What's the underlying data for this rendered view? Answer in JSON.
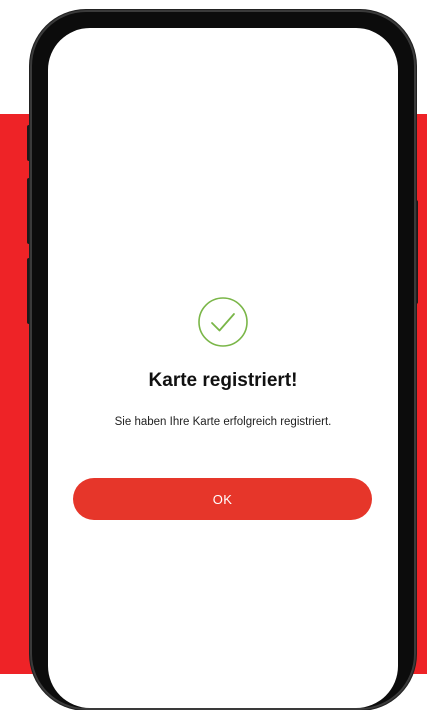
{
  "colors": {
    "background_band": "#ee2327",
    "accent_button": "#e6362a",
    "success_icon": "#7ab648"
  },
  "dialog": {
    "icon": "checkmark-circle-icon",
    "title": "Karte registriert!",
    "message": "Sie haben Ihre Karte erfolgreich registriert.",
    "ok_label": "OK"
  }
}
